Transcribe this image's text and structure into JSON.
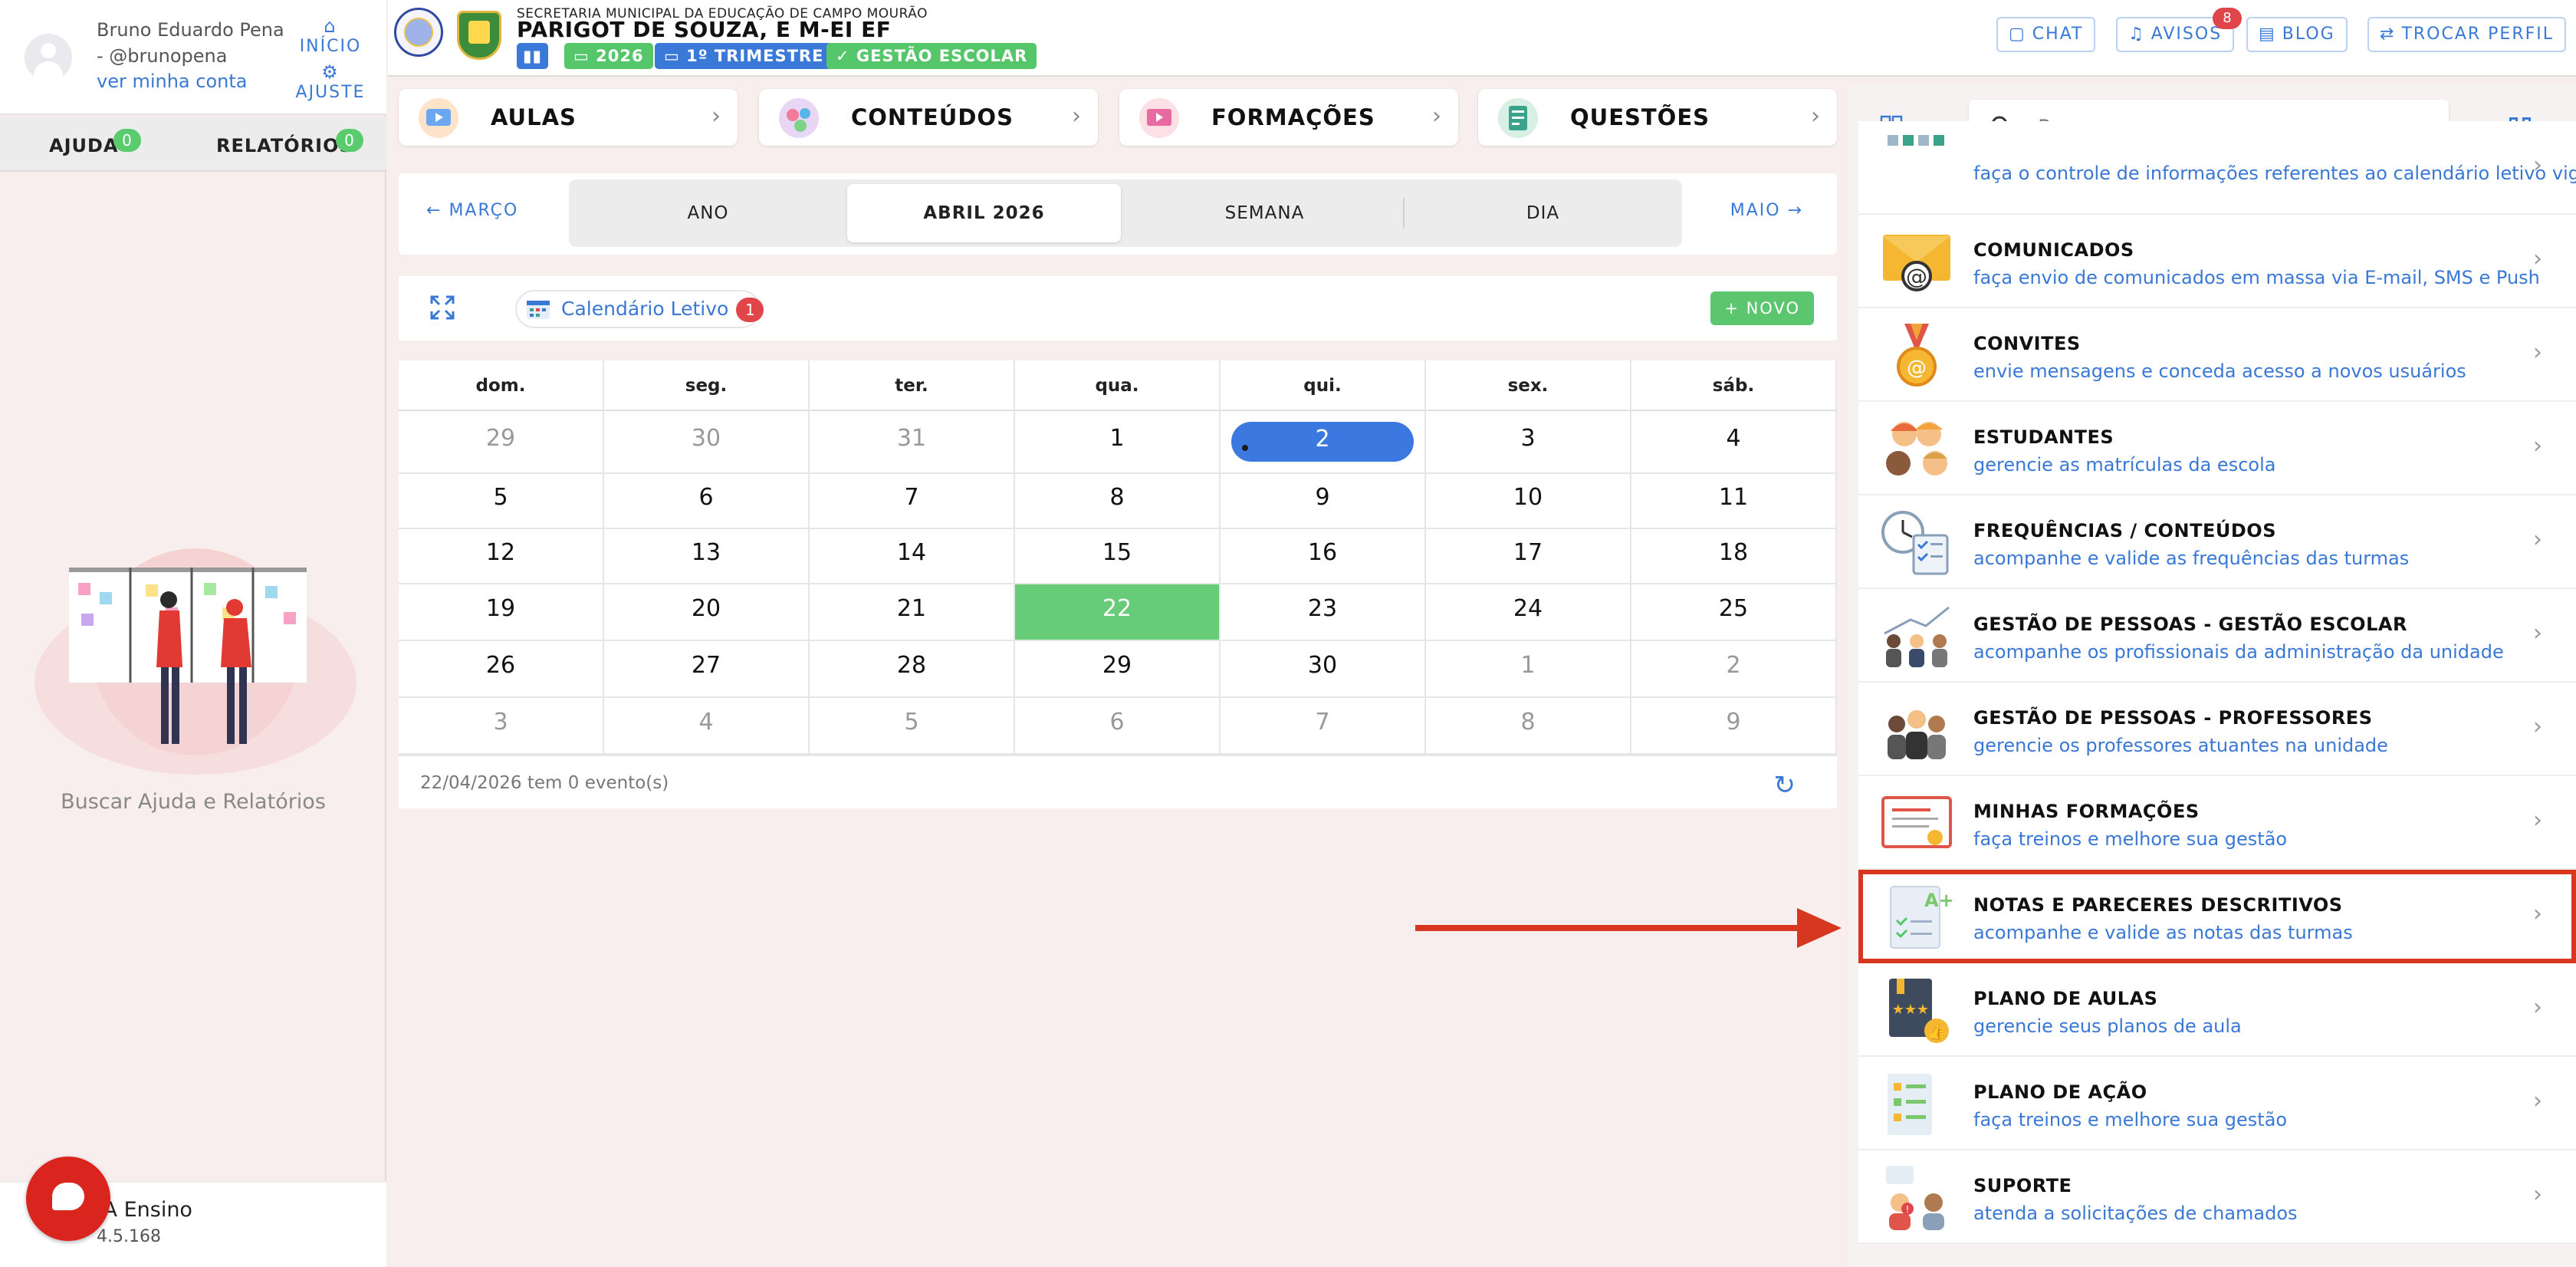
{
  "user": {
    "name": "Bruno Eduardo Pena - @brunopena",
    "account_link": "ver minha conta",
    "nav_home": "INÍCIO",
    "nav_settings": "AJUSTE"
  },
  "sidebar": {
    "tab_help": "AJUDA",
    "tab_help_count": "0",
    "tab_reports": "RELATÓRIOS",
    "tab_reports_count": "0",
    "help_caption": "Buscar Ajuda e Relatórios",
    "app_name": "ATLA Ensino",
    "version": "4.5.168"
  },
  "header": {
    "org": "SECRETARIA MUNICIPAL DA EDUCAÇÃO DE CAMPO MOURÃO",
    "school": "PARIGOT DE SOUZA, E M-EI EF",
    "year": "2026",
    "term": "1º TRIMESTRE",
    "profile": "GESTÃO ESCOLAR",
    "chat": "CHAT",
    "avisos": "AVISOS",
    "avisos_count": "8",
    "blog": "BLOG",
    "switch_profile": "TROCAR PERFIL"
  },
  "quick_links": [
    {
      "label": "AULAS"
    },
    {
      "label": "CONTEÚDOS"
    },
    {
      "label": "FORMAÇÕES"
    },
    {
      "label": "QUESTÕES"
    }
  ],
  "period": {
    "prev": "MARÇO",
    "next": "MAIO",
    "tabs": [
      "ANO",
      "ABRIL 2026",
      "SEMANA",
      "DIA"
    ],
    "active_index": 1
  },
  "toolbar": {
    "calendar_label": "Calendário Letivo",
    "calendar_count": "1",
    "new_button": "NOVO"
  },
  "calendar": {
    "weekdays": [
      "dom.",
      "seg.",
      "ter.",
      "qua.",
      "qui.",
      "sex.",
      "sáb."
    ],
    "weeks": [
      [
        {
          "d": "29",
          "o": true
        },
        {
          "d": "30",
          "o": true
        },
        {
          "d": "31",
          "o": true
        },
        {
          "d": "1"
        },
        {
          "d": "2",
          "today": true
        },
        {
          "d": "3"
        },
        {
          "d": "4"
        }
      ],
      [
        {
          "d": "5"
        },
        {
          "d": "6"
        },
        {
          "d": "7"
        },
        {
          "d": "8"
        },
        {
          "d": "9"
        },
        {
          "d": "10"
        },
        {
          "d": "11"
        }
      ],
      [
        {
          "d": "12"
        },
        {
          "d": "13"
        },
        {
          "d": "14"
        },
        {
          "d": "15"
        },
        {
          "d": "16"
        },
        {
          "d": "17"
        },
        {
          "d": "18"
        }
      ],
      [
        {
          "d": "19"
        },
        {
          "d": "20"
        },
        {
          "d": "21"
        },
        {
          "d": "22",
          "selected": true
        },
        {
          "d": "23"
        },
        {
          "d": "24"
        },
        {
          "d": "25"
        }
      ],
      [
        {
          "d": "26"
        },
        {
          "d": "27"
        },
        {
          "d": "28"
        },
        {
          "d": "29"
        },
        {
          "d": "30"
        },
        {
          "d": "1",
          "o": true
        },
        {
          "d": "2",
          "o": true
        }
      ],
      [
        {
          "d": "3",
          "o": true
        },
        {
          "d": "4",
          "o": true
        },
        {
          "d": "5",
          "o": true
        },
        {
          "d": "6",
          "o": true
        },
        {
          "d": "7",
          "o": true
        },
        {
          "d": "8",
          "o": true
        },
        {
          "d": "9",
          "o": true
        }
      ]
    ],
    "events_summary": "22/04/2026 tem 0 evento(s)"
  },
  "search": {
    "placeholder": "Procurar..."
  },
  "modules": [
    {
      "title": "",
      "desc": "faça o controle de informações referentes ao calendário letivo vigente",
      "icon": "calendar-grid-icon"
    },
    {
      "title": "COMUNICADOS",
      "desc": "faça envio de comunicados em massa via E-mail, SMS e Push",
      "icon": "envelope-icon"
    },
    {
      "title": "CONVITES",
      "desc": "envie mensagens e conceda acesso a novos usuários",
      "icon": "medal-icon"
    },
    {
      "title": "ESTUDANTES",
      "desc": "gerencie as matrículas da escola",
      "icon": "students-icon"
    },
    {
      "title": "FREQUÊNCIAS / CONTEÚDOS",
      "desc": "acompanhe e valide as frequências das turmas",
      "icon": "clock-checklist-icon"
    },
    {
      "title": "GESTÃO DE PESSOAS - GESTÃO ESCOLAR",
      "desc": "acompanhe os profissionais da administração da unidade",
      "icon": "staff-growth-icon"
    },
    {
      "title": "GESTÃO DE PESSOAS - PROFESSORES",
      "desc": "gerencie os professores atuantes na unidade",
      "icon": "teachers-icon"
    },
    {
      "title": "MINHAS FORMAÇÕES",
      "desc": "faça treinos e melhore sua gestão",
      "icon": "certificate-icon"
    },
    {
      "title": "NOTAS E PARECERES DESCRITIVOS",
      "desc": "acompanhe e valide as notas das turmas",
      "icon": "grade-sheet-icon",
      "highlight": true
    },
    {
      "title": "PLANO DE AULAS",
      "desc": "gerencie seus planos de aula",
      "icon": "lesson-book-icon"
    },
    {
      "title": "PLANO DE AÇÃO",
      "desc": "faça treinos e melhore sua gestão",
      "icon": "action-plan-icon"
    },
    {
      "title": "SUPORTE",
      "desc": "atenda a solicitações de chamados",
      "icon": "support-icon"
    }
  ],
  "colors": {
    "accent": "#3a78d6",
    "success": "#5bc66e",
    "alert": "#e0454a",
    "highlight": "#d7361f"
  }
}
